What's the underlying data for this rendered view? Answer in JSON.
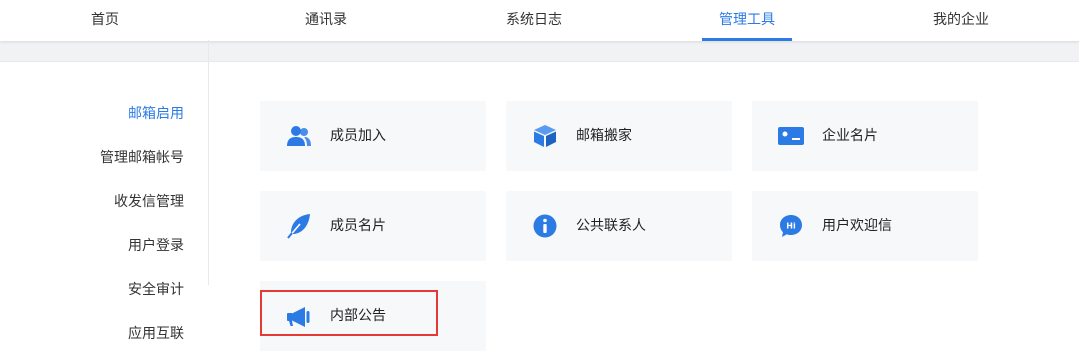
{
  "nav": {
    "items": [
      {
        "label": "首页",
        "active": false
      },
      {
        "label": "通讯录",
        "active": false
      },
      {
        "label": "系统日志",
        "active": false
      },
      {
        "label": "管理工具",
        "active": true
      },
      {
        "label": "我的企业",
        "active": false
      }
    ]
  },
  "sidebar": {
    "items": [
      {
        "label": "邮箱启用",
        "active": true
      },
      {
        "label": "管理邮箱帐号",
        "active": false
      },
      {
        "label": "收发信管理",
        "active": false
      },
      {
        "label": "用户登录",
        "active": false
      },
      {
        "label": "安全审计",
        "active": false
      },
      {
        "label": "应用互联",
        "active": false
      }
    ]
  },
  "cards": [
    {
      "label": "成员加入",
      "icon": "users-icon"
    },
    {
      "label": "邮箱搬家",
      "icon": "box-icon"
    },
    {
      "label": "企业名片",
      "icon": "business-card-icon"
    },
    {
      "label": "成员名片",
      "icon": "feather-icon"
    },
    {
      "label": "公共联系人",
      "icon": "info-icon"
    },
    {
      "label": "用户欢迎信",
      "icon": "hi-chat-icon"
    },
    {
      "label": "内部公告",
      "icon": "megaphone-icon"
    }
  ],
  "accent_color": "#2c7be5",
  "highlight_color": "#e53935"
}
